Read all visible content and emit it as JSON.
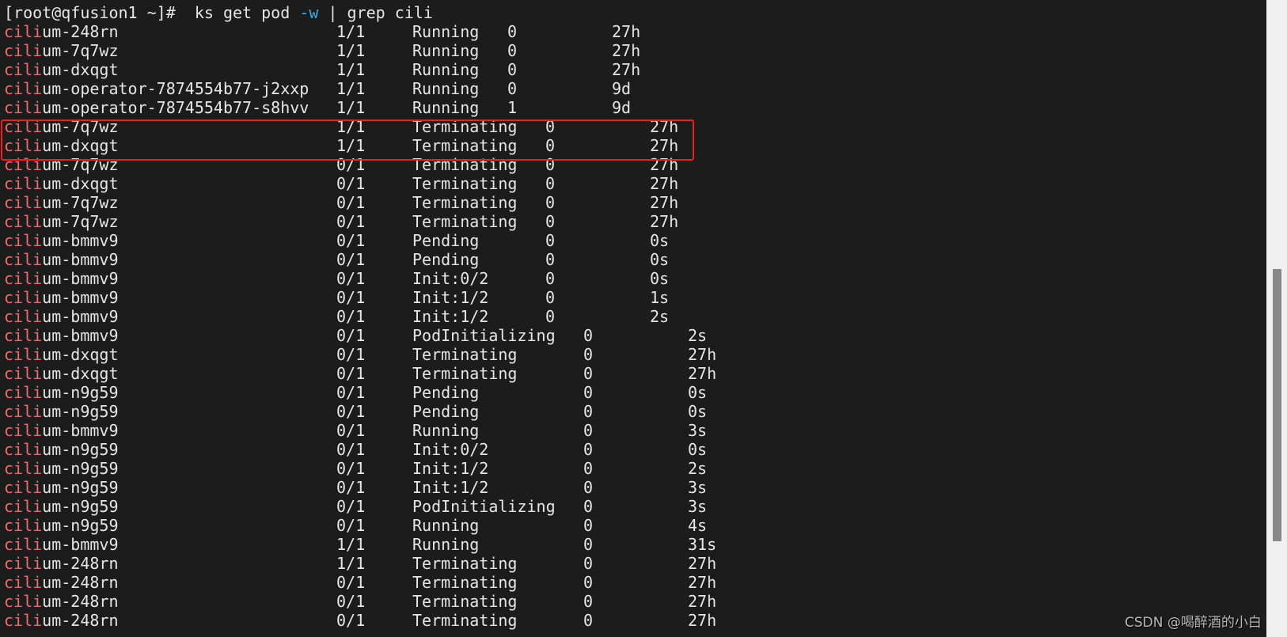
{
  "terminal": {
    "prompt": "[root@qfusion1 ~]#",
    "command_pre": "ks get pod ",
    "command_flag": "-w",
    "command_post": " | grep cili",
    "highlight_term": "cili",
    "rows": [
      [
        "cilium-248rn",
        "1/1",
        "Running",
        "0",
        "27h"
      ],
      [
        "cilium-7q7wz",
        "1/1",
        "Running",
        "0",
        "27h"
      ],
      [
        "cilium-dxqgt",
        "1/1",
        "Running",
        "0",
        "27h"
      ],
      [
        "cilium-operator-7874554b77-j2xxp",
        "1/1",
        "Running",
        "0",
        "9d"
      ],
      [
        "cilium-operator-7874554b77-s8hvv",
        "1/1",
        "Running",
        "1",
        "9d"
      ],
      [
        "cilium-7q7wz",
        "1/1",
        "Terminating",
        "0",
        "27h"
      ],
      [
        "cilium-dxqgt",
        "1/1",
        "Terminating",
        "0",
        "27h"
      ],
      [
        "cilium-7q7wz",
        "0/1",
        "Terminating",
        "0",
        "27h"
      ],
      [
        "cilium-dxqgt",
        "0/1",
        "Terminating",
        "0",
        "27h"
      ],
      [
        "cilium-7q7wz",
        "0/1",
        "Terminating",
        "0",
        "27h"
      ],
      [
        "cilium-7q7wz",
        "0/1",
        "Terminating",
        "0",
        "27h"
      ],
      [
        "cilium-bmmv9",
        "0/1",
        "Pending",
        "0",
        "0s"
      ],
      [
        "cilium-bmmv9",
        "0/1",
        "Pending",
        "0",
        "0s"
      ],
      [
        "cilium-bmmv9",
        "0/1",
        "Init:0/2",
        "0",
        "0s"
      ],
      [
        "cilium-bmmv9",
        "0/1",
        "Init:1/2",
        "0",
        "1s"
      ],
      [
        "cilium-bmmv9",
        "0/1",
        "Init:1/2",
        "0",
        "2s"
      ],
      [
        "cilium-bmmv9",
        "0/1",
        "PodInitializing",
        "0",
        "2s"
      ],
      [
        "cilium-dxqgt",
        "0/1",
        "Terminating",
        "0",
        "27h"
      ],
      [
        "cilium-dxqgt",
        "0/1",
        "Terminating",
        "0",
        "27h"
      ],
      [
        "cilium-n9g59",
        "0/1",
        "Pending",
        "0",
        "0s"
      ],
      [
        "cilium-n9g59",
        "0/1",
        "Pending",
        "0",
        "0s"
      ],
      [
        "cilium-bmmv9",
        "0/1",
        "Running",
        "0",
        "3s"
      ],
      [
        "cilium-n9g59",
        "0/1",
        "Init:0/2",
        "0",
        "0s"
      ],
      [
        "cilium-n9g59",
        "0/1",
        "Init:1/2",
        "0",
        "2s"
      ],
      [
        "cilium-n9g59",
        "0/1",
        "Init:1/2",
        "0",
        "3s"
      ],
      [
        "cilium-n9g59",
        "0/1",
        "PodInitializing",
        "0",
        "3s"
      ],
      [
        "cilium-n9g59",
        "0/1",
        "Running",
        "0",
        "4s"
      ],
      [
        "cilium-bmmv9",
        "1/1",
        "Running",
        "0",
        "31s"
      ],
      [
        "cilium-248rn",
        "1/1",
        "Terminating",
        "0",
        "27h"
      ],
      [
        "cilium-248rn",
        "0/1",
        "Terminating",
        "0",
        "27h"
      ],
      [
        "cilium-248rn",
        "0/1",
        "Terminating",
        "0",
        "27h"
      ],
      [
        "cilium-248rn",
        "0/1",
        "Terminating",
        "0",
        "27h"
      ]
    ]
  },
  "colors": {
    "background": "#1c1c1c",
    "text": "#e6e6e6",
    "grep_highlight": "#ef6b6b",
    "flag": "#3fa9e6",
    "annotation_box": "#e8231f"
  },
  "watermark": "CSDN @喝醉酒的小白"
}
